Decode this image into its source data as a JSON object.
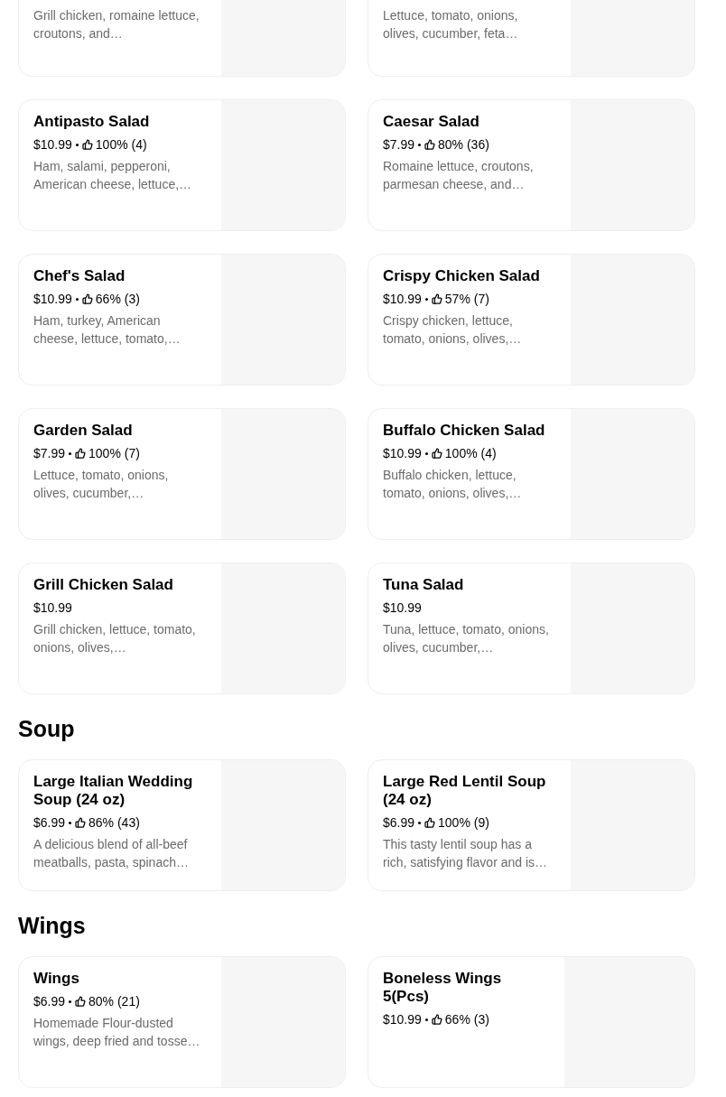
{
  "sections": [
    {
      "items": [
        {
          "description": "Grill chicken, romaine lettuce, croutons, and…"
        },
        {
          "description": "Lettuce, tomato, onions, olives, cucumber, feta…"
        },
        {
          "title": "Antipasto Salad",
          "price": "$10.99",
          "rating": "100% (4)",
          "description": "Ham, salami, pepperoni, American cheese, lettuce,…"
        },
        {
          "title": "Caesar Salad",
          "price": "$7.99",
          "rating": "80% (36)",
          "description": "Romaine lettuce, croutons, parmesan cheese, and…"
        },
        {
          "title": "Chef's Salad",
          "price": "$10.99",
          "rating": "66% (3)",
          "description": "Ham, turkey, American cheese, lettuce, tomato,…"
        },
        {
          "title": "Crispy Chicken Salad",
          "price": "$10.99",
          "rating": "57% (7)",
          "description": "Crispy chicken, lettuce, tomato, onions, olives,…"
        },
        {
          "title": "Garden Salad",
          "price": "$7.99",
          "rating": "100% (7)",
          "description": "Lettuce, tomato, onions, olives, cucumber,…"
        },
        {
          "title": "Buffalo Chicken Salad",
          "price": "$10.99",
          "rating": "100% (4)",
          "description": "Buffalo chicken, lettuce, tomato, onions, olives,…"
        },
        {
          "title": "Grill Chicken Salad",
          "price": "$10.99",
          "description": "Grill chicken, lettuce, tomato, onions, olives,…"
        },
        {
          "title": "Tuna Salad",
          "price": "$10.99",
          "description": "Tuna, lettuce, tomato, onions, olives, cucumber,…"
        }
      ]
    },
    {
      "title": "Soup",
      "items": [
        {
          "title": "Large Italian Wedding Soup (24 oz)",
          "price": "$6.99",
          "rating": "86% (43)",
          "description": "A delicious blend of all-beef meatballs, pasta, spinach…"
        },
        {
          "title": "Large Red Lentil Soup (24 oz)",
          "price": "$6.99",
          "rating": "100% (9)",
          "description": "This tasty lentil soup has a rich, satisfying flavor and is…"
        }
      ]
    },
    {
      "title": "Wings",
      "items": [
        {
          "title": "Wings",
          "price": "$6.99",
          "rating": "80% (21)",
          "description": "Homemade Flour-dusted wings, deep fried and tosse…"
        },
        {
          "title": "Boneless Wings 5(Pcs)",
          "price": "$10.99",
          "rating": "66% (3)"
        }
      ]
    }
  ]
}
